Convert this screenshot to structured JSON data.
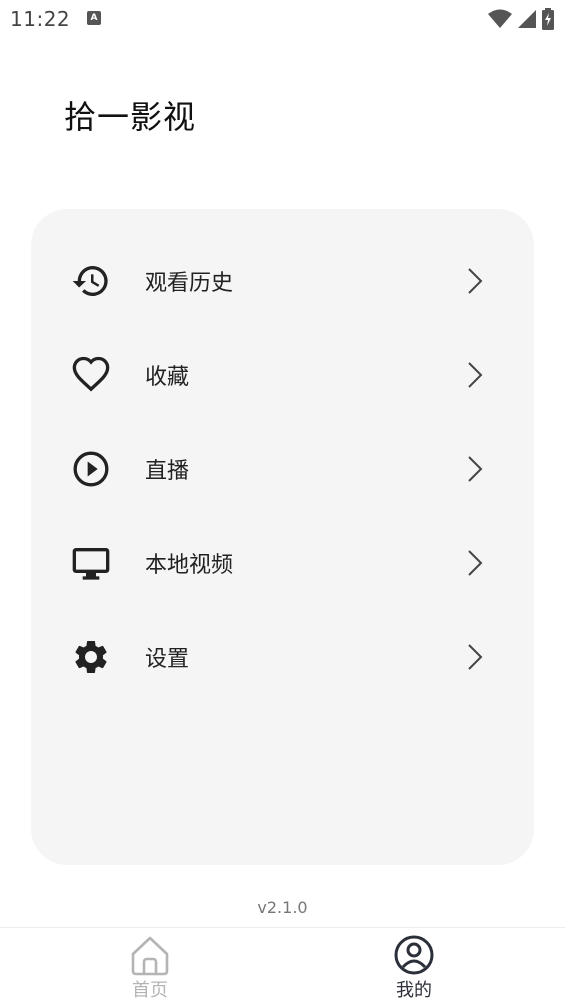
{
  "status_bar": {
    "time": "11:22",
    "notification_glyph": "A",
    "icons": [
      "wifi-icon",
      "signal-icon",
      "battery-charging-icon"
    ]
  },
  "app_title": "拾一影视",
  "menu": {
    "items": [
      {
        "label": "观看历史",
        "icon": "history-icon"
      },
      {
        "label": "收藏",
        "icon": "heart-icon"
      },
      {
        "label": "直播",
        "icon": "play-circle-icon"
      },
      {
        "label": "本地视频",
        "icon": "monitor-icon"
      },
      {
        "label": "设置",
        "icon": "gear-icon"
      }
    ]
  },
  "version": "v2.1.0",
  "bottom_nav": {
    "tabs": [
      {
        "label": "首页",
        "icon": "home-icon",
        "active": false
      },
      {
        "label": "我的",
        "icon": "user-icon",
        "active": true
      }
    ]
  },
  "colors": {
    "card_background": "#f5f5f5",
    "icon_color": "#222222",
    "active_tab": "#2b2f3a",
    "inactive_tab": "#b4b4b4"
  }
}
